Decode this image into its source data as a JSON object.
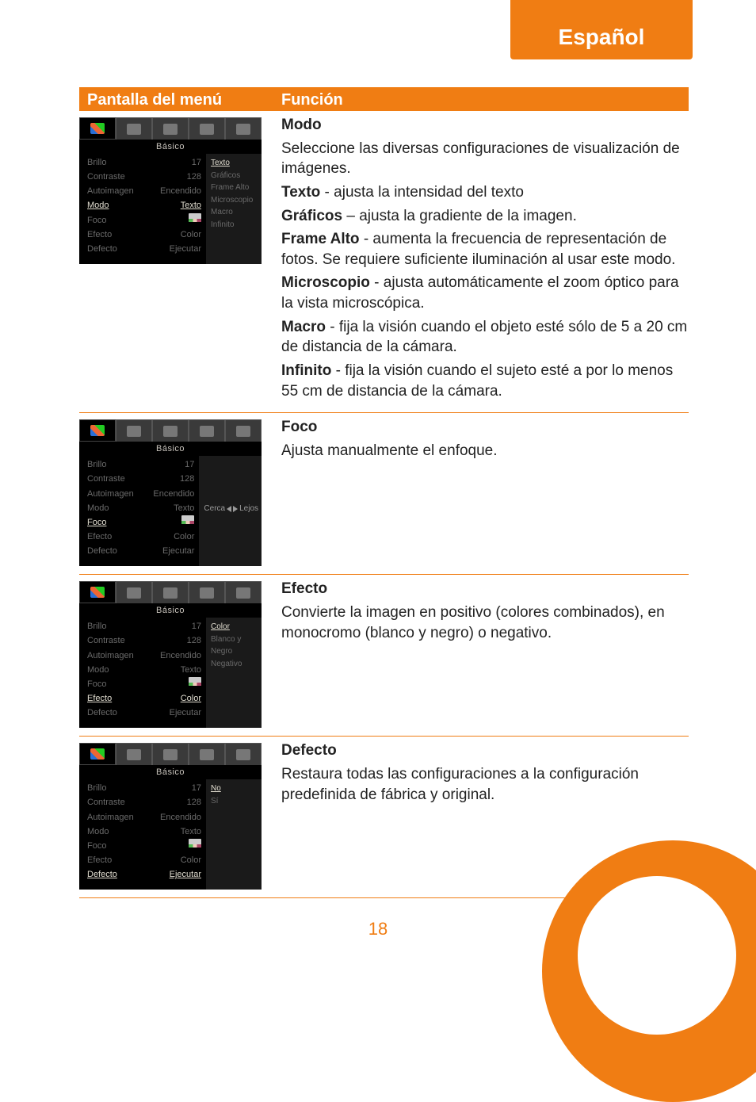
{
  "lang_tab": "Español",
  "page_number": "18",
  "headers": {
    "left": "Pantalla del menú",
    "right": "Función"
  },
  "menu_common": {
    "title": "Básico",
    "rows": {
      "brillo": {
        "label": "Brillo",
        "value": "17"
      },
      "contraste": {
        "label": "Contraste",
        "value": "128"
      },
      "autoimg": {
        "label": "Autoimagen",
        "value": "Encendido"
      },
      "modo": {
        "label": "Modo",
        "value": "Texto"
      },
      "foco": {
        "label": "Foco",
        "value": ""
      },
      "efecto": {
        "label": "Efecto",
        "value": "Color"
      },
      "defecto": {
        "label": "Defecto",
        "value": "Ejecutar"
      }
    }
  },
  "sections": {
    "modo": {
      "title": "Modo",
      "desc": "Seleccione las diversas configuraciones de visualización de imágenes.",
      "items": [
        {
          "b": "Texto",
          "t": " - ajusta la intensidad del texto"
        },
        {
          "b": "Gráficos",
          "t": " – ajusta la gradiente de la imagen."
        },
        {
          "b": "Frame Alto",
          "t": " - aumenta la frecuencia de representación de fotos. Se requiere suficiente iluminación al usar este modo."
        },
        {
          "b": "Microscopio",
          "t": " - ajusta automáticamente el zoom óptico para la vista microscópica."
        },
        {
          "b": "Macro",
          "t": " - fija la visión cuando el objeto esté sólo de 5 a 20 cm de distancia de la cámara."
        },
        {
          "b": "Infinito",
          "t": " - fija la visión cuando el sujeto esté a por lo menos 55 cm de distancia de la cámara."
        }
      ],
      "submenu": [
        "Texto",
        "Gráficos",
        "Frame Alto",
        "Microscopio",
        "Macro",
        "Infinito"
      ]
    },
    "foco": {
      "title": "Foco",
      "desc": "Ajusta manualmente el enfoque.",
      "slider": {
        "left": "Cerca",
        "right": "Lejos"
      }
    },
    "efecto": {
      "title": "Efecto",
      "desc": "Convierte la imagen en positivo (colores combinados), en monocromo (blanco y negro) o negativo.",
      "submenu": [
        "Color",
        "Blanco y Negro",
        "Negativo"
      ]
    },
    "defecto": {
      "title": "Defecto",
      "desc": "Restaura todas las configuraciones a la configuración predefinida de fábrica y original.",
      "submenu": [
        "No",
        "Sí"
      ]
    }
  }
}
